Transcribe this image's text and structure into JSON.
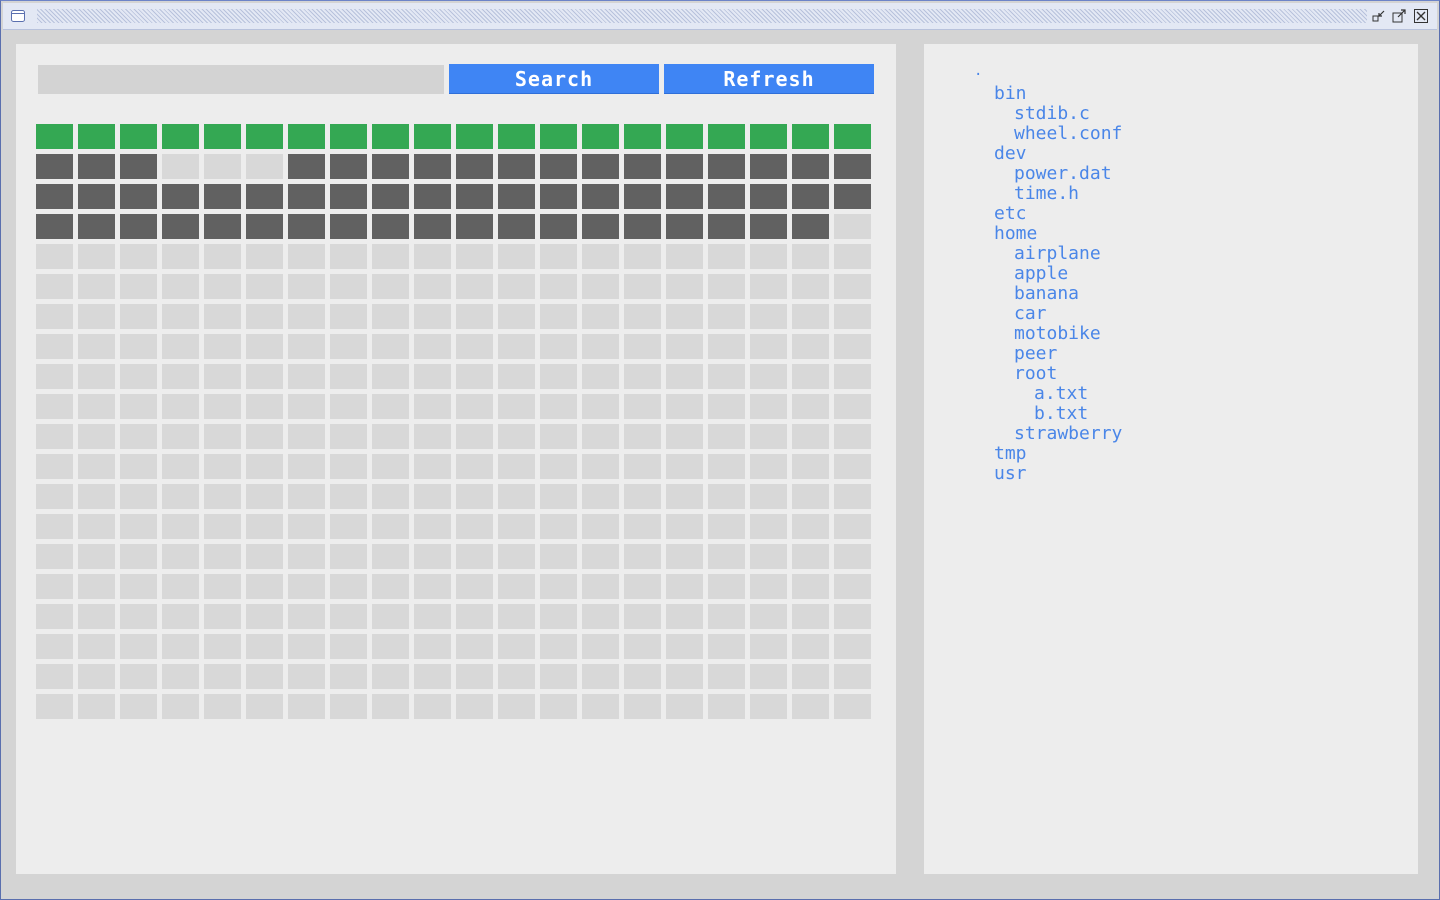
{
  "toolbar": {
    "search_value": "",
    "search_label": "Search",
    "refresh_label": "Refresh"
  },
  "colors": {
    "accent": "#3f85f4",
    "header_cell": "#34a853",
    "used_cell": "#616161",
    "free_cell": "#d8d8d8",
    "tree_text": "#4a86e8"
  },
  "disk_grid": {
    "columns": 20,
    "rows": [
      "HHHHHHHHHHHHHHHHHHHH",
      "UUUFFFUUUUUUUUUUUUUU",
      "UUUUUUUUUUUUUUUUUUUU",
      "UUUUUUUUUUUUUUUUUUUF",
      "FFFFFFFFFFFFFFFFFFFF",
      "FFFFFFFFFFFFFFFFFFFF",
      "FFFFFFFFFFFFFFFFFFFF",
      "FFFFFFFFFFFFFFFFFFFF",
      "FFFFFFFFFFFFFFFFFFFF",
      "FFFFFFFFFFFFFFFFFFFF",
      "FFFFFFFFFFFFFFFFFFFF",
      "FFFFFFFFFFFFFFFFFFFF",
      "FFFFFFFFFFFFFFFFFFFF",
      "FFFFFFFFFFFFFFFFFFFF",
      "FFFFFFFFFFFFFFFFFFFF",
      "FFFFFFFFFFFFFFFFFFFF",
      "FFFFFFFFFFFFFFFFFFFF",
      "FFFFFFFFFFFFFFFFFFFF",
      "FFFFFFFFFFFFFFFFFFFF",
      "FFFFFFFFFFFFFFFFFFFF"
    ]
  },
  "file_tree": [
    {
      "name": ".",
      "depth": 0
    },
    {
      "name": "bin",
      "depth": 1
    },
    {
      "name": "stdib.c",
      "depth": 2
    },
    {
      "name": "wheel.conf",
      "depth": 2
    },
    {
      "name": "dev",
      "depth": 1
    },
    {
      "name": "power.dat",
      "depth": 2
    },
    {
      "name": "time.h",
      "depth": 2
    },
    {
      "name": "etc",
      "depth": 1
    },
    {
      "name": "home",
      "depth": 1
    },
    {
      "name": "airplane",
      "depth": 2
    },
    {
      "name": "apple",
      "depth": 2
    },
    {
      "name": "banana",
      "depth": 2
    },
    {
      "name": "car",
      "depth": 2
    },
    {
      "name": "motobike",
      "depth": 2
    },
    {
      "name": "peer",
      "depth": 2
    },
    {
      "name": "root",
      "depth": 2
    },
    {
      "name": "a.txt",
      "depth": 3
    },
    {
      "name": "b.txt",
      "depth": 3
    },
    {
      "name": "strawberry",
      "depth": 2
    },
    {
      "name": "tmp",
      "depth": 1
    },
    {
      "name": "usr",
      "depth": 1
    }
  ]
}
